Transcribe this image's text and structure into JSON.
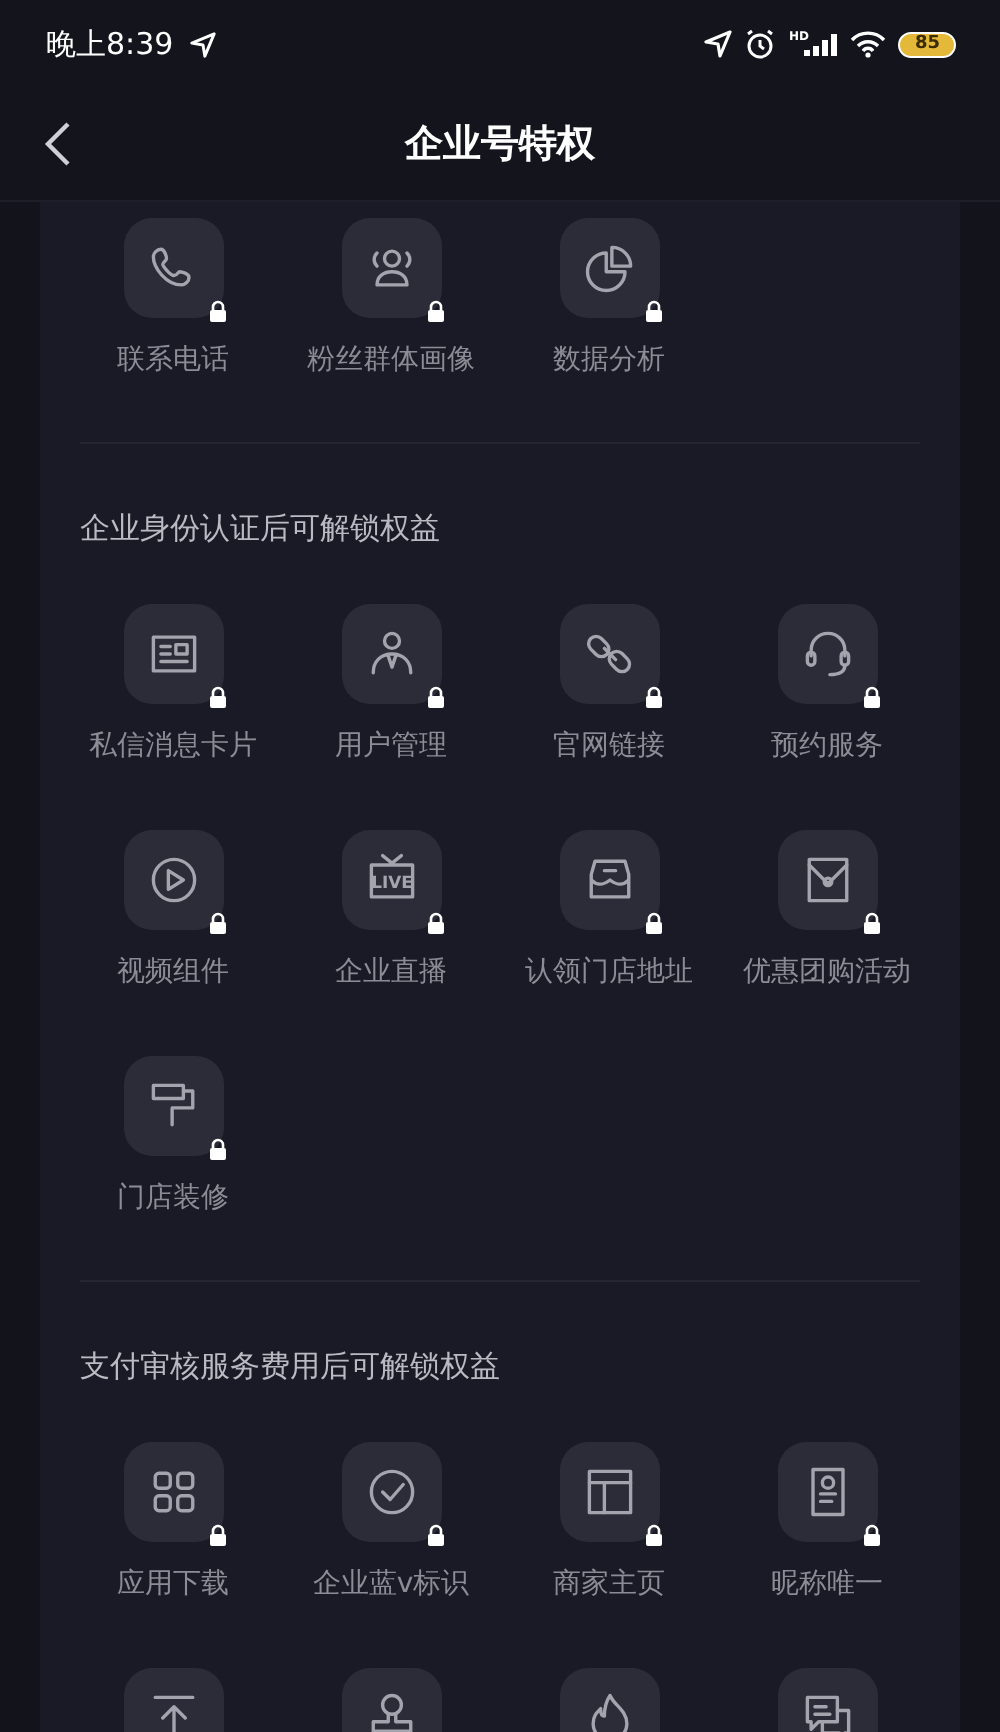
{
  "status_bar": {
    "time": "晚上8:39",
    "network": "HD",
    "battery": "85"
  },
  "nav": {
    "title": "企业号特权"
  },
  "sections": [
    {
      "items": [
        {
          "kind": "feature",
          "label": "联系电话",
          "locked": true
        },
        {
          "kind": "feature",
          "label": "粉丝群体画像",
          "locked": true
        },
        {
          "kind": "feature",
          "label": "数据分析",
          "locked": true
        }
      ]
    },
    {
      "title": "企业身份认证后可解锁权益",
      "items": [
        {
          "kind": "feature",
          "label": "私信消息卡片",
          "locked": true
        },
        {
          "kind": "feature",
          "label": "用户管理",
          "locked": true
        },
        {
          "kind": "feature",
          "label": "官网链接",
          "locked": true
        },
        {
          "kind": "feature",
          "label": "预约服务",
          "locked": true
        },
        {
          "kind": "feature",
          "label": "视频组件",
          "locked": true
        },
        {
          "kind": "feature",
          "label": "企业直播",
          "locked": true,
          "icon_text": "LIVE"
        },
        {
          "kind": "feature",
          "label": "认领门店地址",
          "locked": true
        },
        {
          "kind": "feature",
          "label": "优惠团购活动",
          "locked": true
        },
        {
          "kind": "feature",
          "label": "门店装修",
          "locked": true
        }
      ]
    },
    {
      "title": "支付审核服务费用后可解锁权益",
      "items": [
        {
          "kind": "feature",
          "label": "应用下载",
          "locked": true
        },
        {
          "kind": "feature",
          "label": "企业蓝v标识",
          "locked": true
        },
        {
          "kind": "feature",
          "label": "商家主页",
          "locked": true
        },
        {
          "kind": "feature",
          "label": "昵称唯一",
          "locked": true
        },
        {
          "kind": "tile"
        },
        {
          "kind": "tile"
        },
        {
          "kind": "tile"
        },
        {
          "kind": "tile"
        }
      ]
    }
  ]
}
